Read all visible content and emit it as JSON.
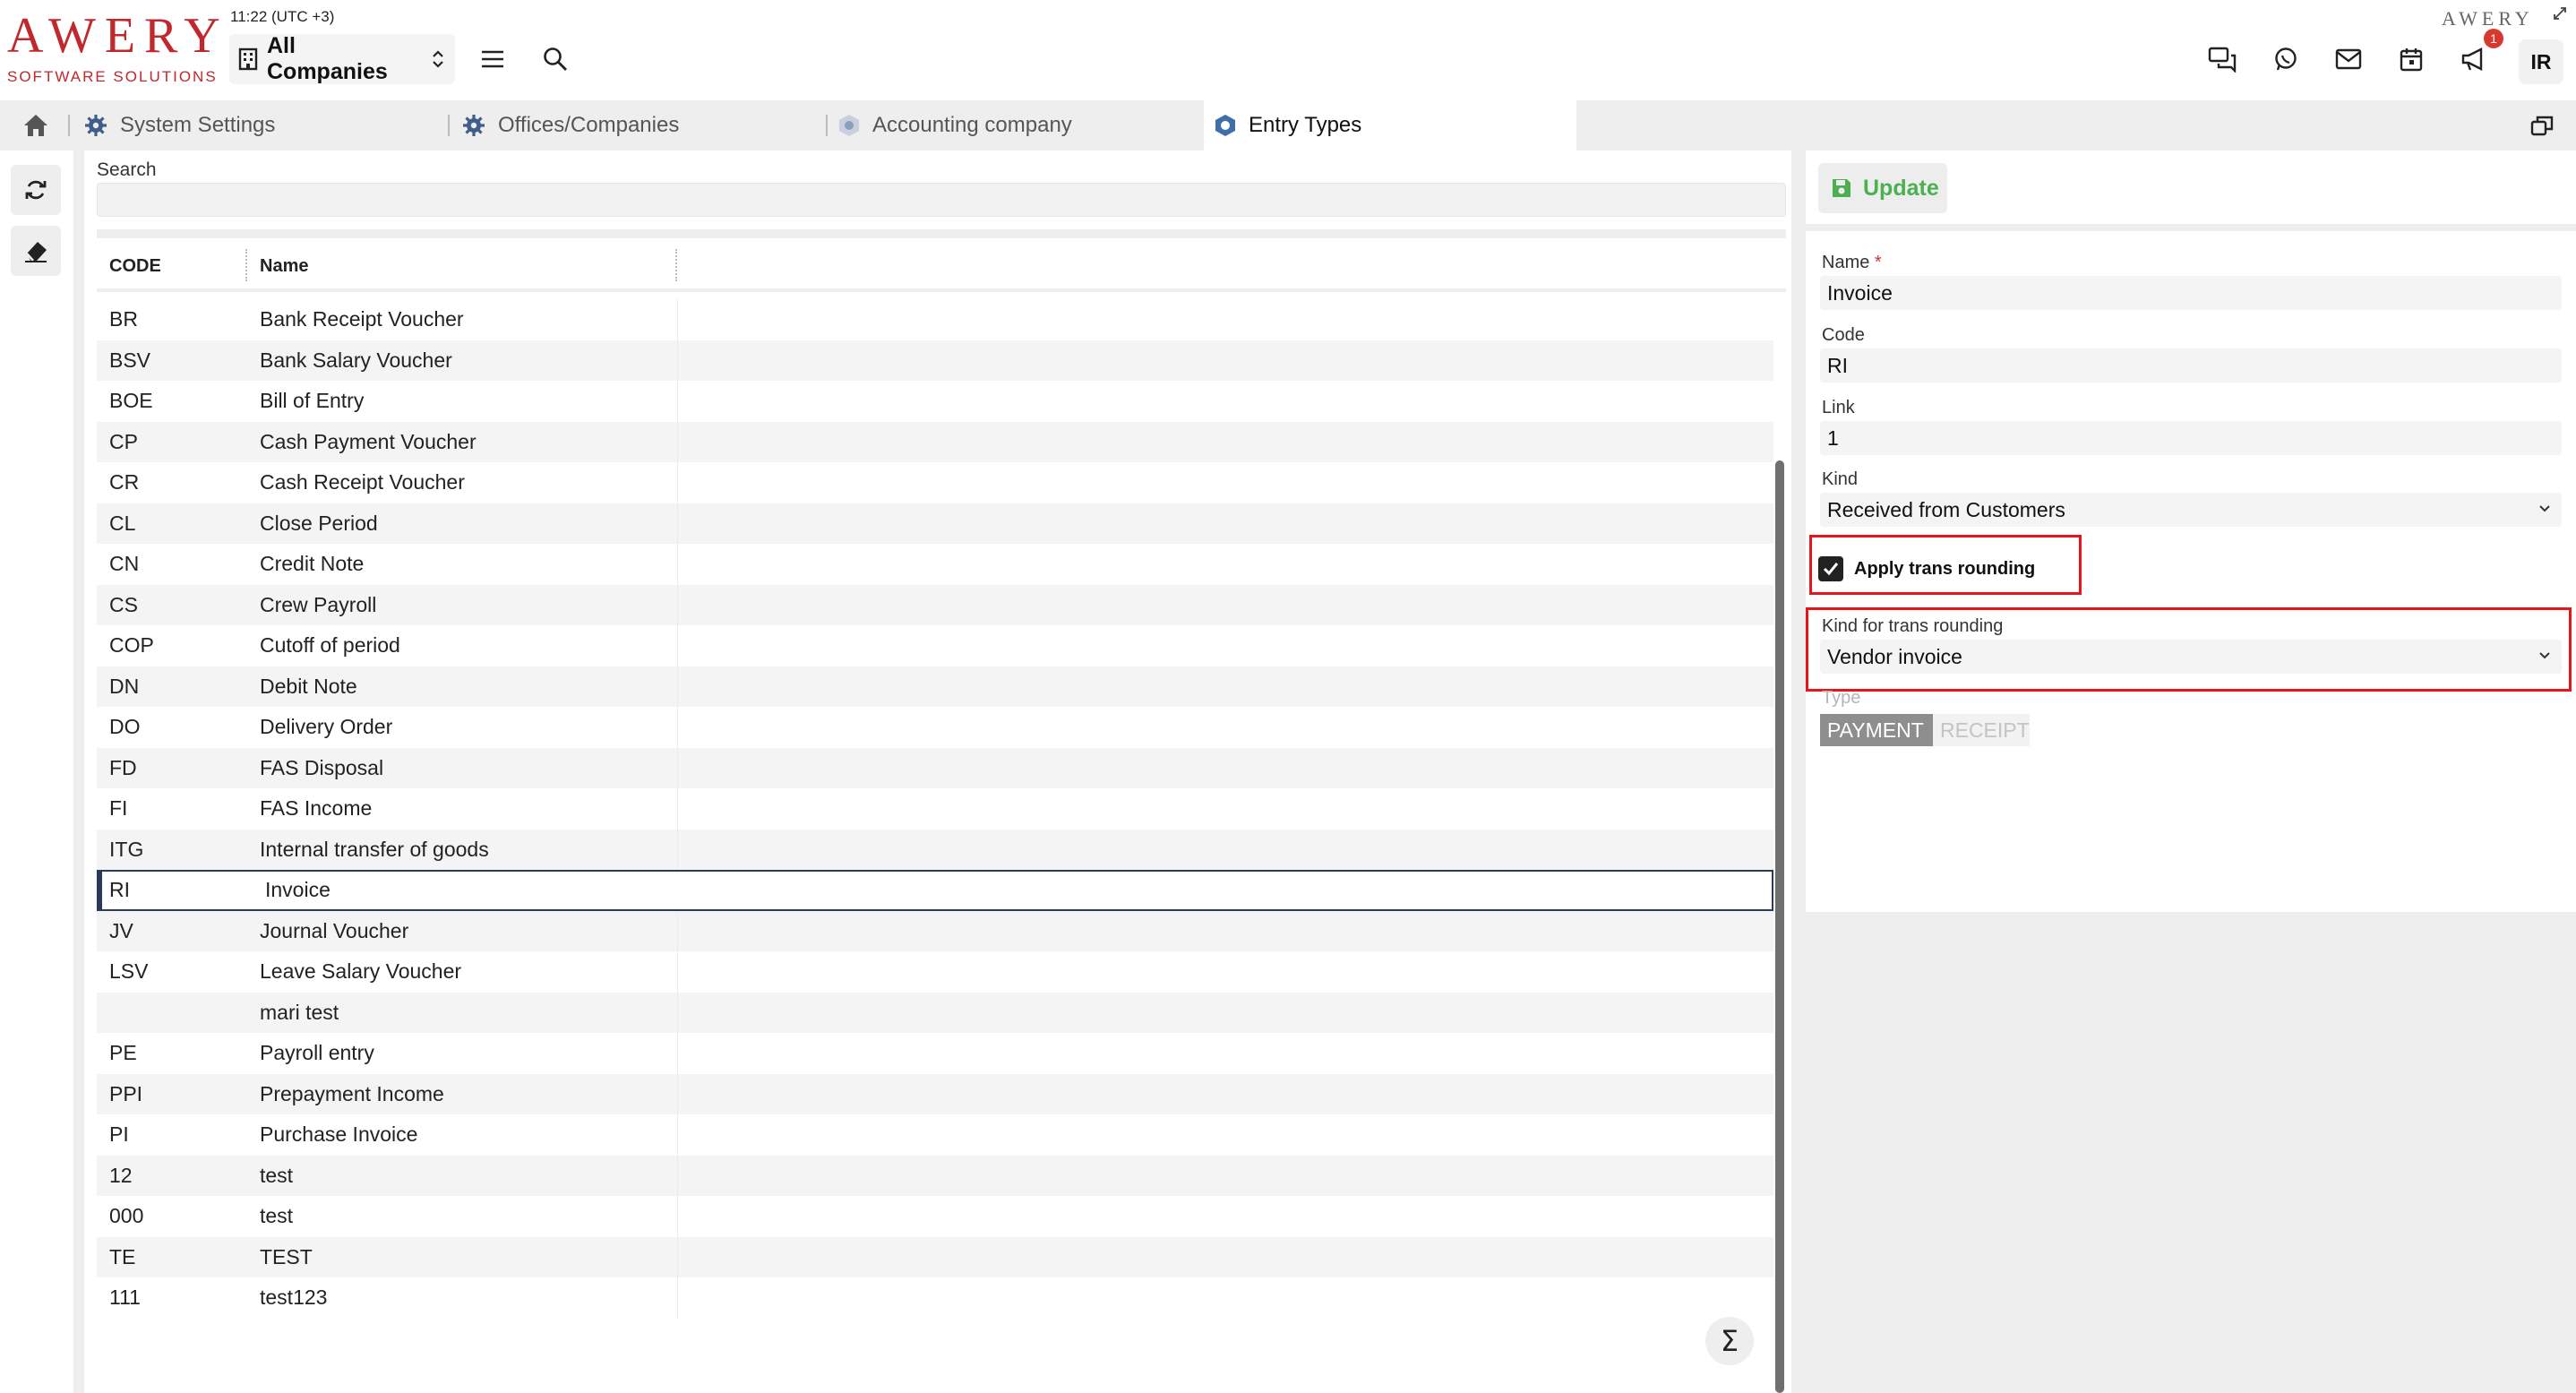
{
  "header": {
    "logo_text": "AWERY",
    "logo_subtitle": "SOFTWARE SOLUTIONS",
    "clock": "11:22 (UTC +3)",
    "company_selector": "All Companies",
    "brand_small": "AWERY",
    "notification_count": "1",
    "user_initials": "IR"
  },
  "tabs": [
    {
      "label": "System Settings",
      "icon": "gear-icon"
    },
    {
      "label": "Offices/Companies",
      "icon": "gear-icon"
    },
    {
      "label": "Accounting company",
      "icon": "hexagon-icon"
    },
    {
      "label": "Entry Types",
      "icon": "hexagon-icon",
      "active": true
    }
  ],
  "list": {
    "search_label": "Search",
    "search_value": "",
    "columns": {
      "code": "CODE",
      "name": "Name"
    },
    "rows": [
      {
        "code": "BR",
        "name": "Bank Receipt Voucher"
      },
      {
        "code": "BSV",
        "name": "Bank Salary Voucher"
      },
      {
        "code": "BOE",
        "name": "Bill of Entry"
      },
      {
        "code": "CP",
        "name": "Cash Payment Voucher"
      },
      {
        "code": "CR",
        "name": "Cash Receipt Voucher"
      },
      {
        "code": "CL",
        "name": "Close Period"
      },
      {
        "code": "CN",
        "name": "Credit Note"
      },
      {
        "code": "CS",
        "name": "Crew Payroll"
      },
      {
        "code": "COP",
        "name": "Cutoff of period"
      },
      {
        "code": "DN",
        "name": "Debit Note"
      },
      {
        "code": "DO",
        "name": "Delivery Order"
      },
      {
        "code": "FD",
        "name": "FAS Disposal"
      },
      {
        "code": "FI",
        "name": "FAS Income"
      },
      {
        "code": "ITG",
        "name": "Internal transfer of goods"
      },
      {
        "code": "RI",
        "name": "Invoice",
        "selected": true
      },
      {
        "code": "JV",
        "name": "Journal Voucher"
      },
      {
        "code": "LSV",
        "name": "Leave Salary Voucher"
      },
      {
        "code": "",
        "name": "mari test"
      },
      {
        "code": "PE",
        "name": "Payroll entry"
      },
      {
        "code": "PPI",
        "name": "Prepayment Income"
      },
      {
        "code": "PI",
        "name": "Purchase Invoice"
      },
      {
        "code": "12",
        "name": "test"
      },
      {
        "code": "000",
        "name": "test"
      },
      {
        "code": "TE",
        "name": "TEST"
      },
      {
        "code": "111",
        "name": "test123"
      }
    ],
    "totals_symbol": "Σ"
  },
  "detail": {
    "update_label": "Update",
    "name_label": "Name",
    "required_mark": "*",
    "name_value": "Invoice",
    "code_label": "Code",
    "code_value": "RI",
    "link_label": "Link",
    "link_value": "1",
    "kind_label": "Kind",
    "kind_value": "Received from Customers",
    "apply_rounding_label": "Apply trans rounding",
    "apply_rounding_checked": true,
    "kind_rounding_label": "Kind for trans rounding",
    "kind_rounding_value": "Vendor invoice",
    "type_label": "Type",
    "type_options": [
      "PAYMENT",
      "RECEIPT"
    ],
    "type_selected": "PAYMENT"
  },
  "colors": {
    "brand_red": "#c0282d",
    "highlight_red": "#e5151b",
    "update_green": "#4caf50",
    "selected_row_border": "#2a3a5a"
  }
}
